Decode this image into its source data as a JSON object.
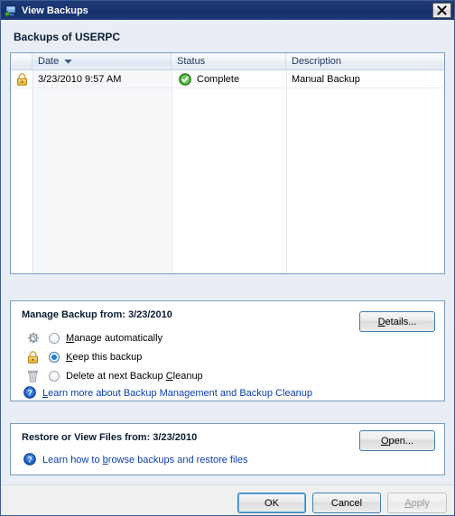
{
  "window": {
    "title": "View Backups",
    "icon": "computer-backup-icon",
    "close_label": "Close"
  },
  "heading": "Backups of USERPC",
  "listview": {
    "columns": [
      {
        "key": "icon",
        "label": "",
        "sorted": false
      },
      {
        "key": "date",
        "label": "Date",
        "sorted": true,
        "sort_dir": "descending"
      },
      {
        "key": "status",
        "label": "Status",
        "sorted": false
      },
      {
        "key": "description",
        "label": "Description",
        "sorted": false
      }
    ],
    "rows": [
      {
        "icon": "lock-icon",
        "date": "3/23/2010 9:57 AM",
        "status_icon": "check-circle-icon",
        "status": "Complete",
        "description": "Manual Backup"
      }
    ]
  },
  "manage_group": {
    "title": "Manage Backup from: 3/23/2010",
    "details_button": "Details...",
    "details_accel": "D",
    "options": [
      {
        "icon": "gear-icon",
        "label_pre": "",
        "accel": "M",
        "label_post": "anage automatically",
        "selected": false
      },
      {
        "icon": "lock-icon",
        "label_pre": "",
        "accel": "K",
        "label_post": "eep this backup",
        "selected": true
      },
      {
        "icon": "trash-icon",
        "label_pre": "Delete at next Backup ",
        "accel": "C",
        "label_post": "leanup",
        "selected": false
      }
    ],
    "help_link": {
      "icon": "help-icon",
      "pre": "",
      "accel": "L",
      "post": "earn more about Backup Management and Backup Cleanup"
    }
  },
  "restore_group": {
    "title": "Restore or View Files from: 3/23/2010",
    "open_button": "Open...",
    "open_accel": "O",
    "help_link": {
      "icon": "help-icon",
      "pre": "Learn how to ",
      "accel": "b",
      "post": "rowse backups and restore files"
    }
  },
  "footer": {
    "ok": "OK",
    "cancel": "Cancel",
    "apply": "Apply",
    "apply_accel": "A",
    "apply_enabled": false
  },
  "colors": {
    "titlebar": "#1a3470",
    "dialog_bg": "#e9eef6",
    "group_border": "#7d9bc1",
    "link": "#0b3fa8",
    "status_ok": "#2f9e2f",
    "lock": "#e0a92b",
    "footer_bg": "#f0f0f0"
  }
}
